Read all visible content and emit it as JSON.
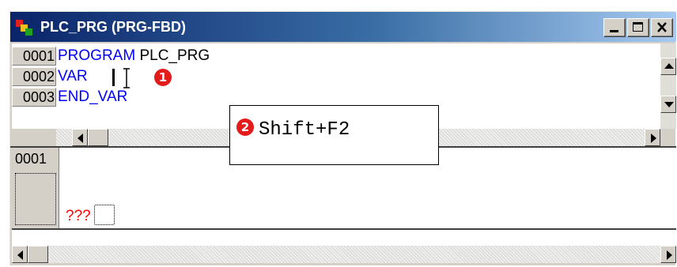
{
  "window": {
    "title": "PLC_PRG (PRG-FBD)",
    "controls": {
      "minimize": "_",
      "maximize": "□",
      "close": "×"
    }
  },
  "declaration_editor": {
    "lines": [
      {
        "number": "0001",
        "keyword": "PROGRAM",
        "text": " PLC_PRG"
      },
      {
        "number": "0002",
        "keyword": "VAR",
        "text": ""
      },
      {
        "number": "0003",
        "keyword": "END_VAR",
        "text": ""
      }
    ]
  },
  "annotations": {
    "step1": "1",
    "step2": "2",
    "shortcut": "Shift+F2"
  },
  "body_editor": {
    "network_number": "0001",
    "placeholder_text": "???"
  },
  "colors": {
    "keyword": "#0000ff",
    "placeholder": "#ff0000",
    "badge": "#e31b1b",
    "title_bar": "#0a246a"
  },
  "icons": [
    "app-icon",
    "minimize-icon",
    "maximize-icon",
    "close-icon",
    "scroll-up-icon",
    "scroll-down-icon",
    "scroll-left-icon",
    "scroll-right-icon",
    "text-cursor-icon"
  ]
}
